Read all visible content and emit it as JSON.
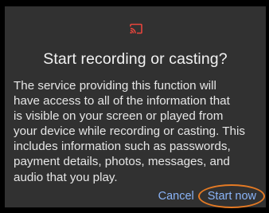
{
  "dialog": {
    "icon": "cast-icon",
    "title": "Start recording or casting?",
    "body_lines": [
      "The service providing this function will",
      "have access to all of the information that",
      "is visible on your screen or played from",
      "your device while recording or casting. This",
      "includes information such as passwords,",
      "payment details, photos, messages, and",
      "audio that you play."
    ],
    "cancel_label": "Cancel",
    "start_label": "Start now"
  },
  "colors": {
    "background": "#000000",
    "dialog": "#313131",
    "accent": "#8ab4f8",
    "icon": "#e8453c",
    "highlight": "#e47a24"
  }
}
